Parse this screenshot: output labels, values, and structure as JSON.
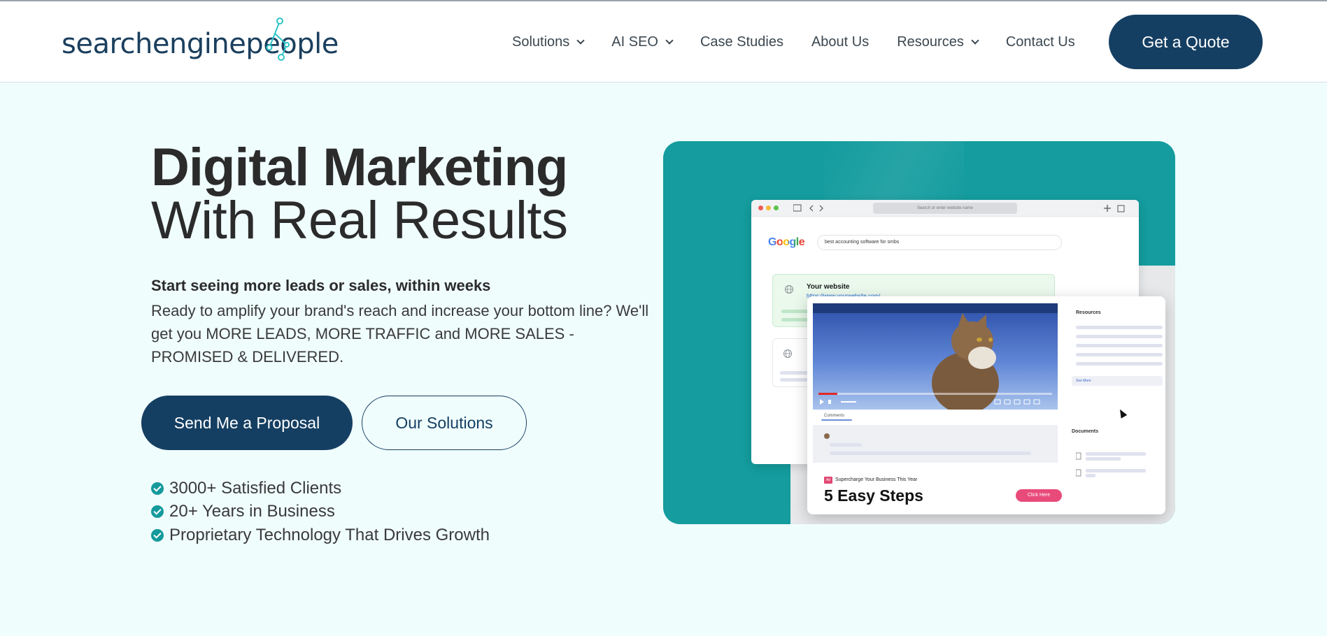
{
  "header": {
    "logo_text": "searchenginepeople",
    "nav": [
      {
        "label": "Solutions",
        "has_dropdown": true
      },
      {
        "label": "AI SEO",
        "has_dropdown": true
      },
      {
        "label": "Case Studies",
        "has_dropdown": false
      },
      {
        "label": "About Us",
        "has_dropdown": false
      },
      {
        "label": "Resources",
        "has_dropdown": true
      },
      {
        "label": "Contact Us",
        "has_dropdown": false
      }
    ],
    "cta_label": "Get a Quote"
  },
  "hero": {
    "title_line1": "Digital Marketing",
    "title_line2": "With Real Results",
    "lead": "Start seeing more leads or sales, within weeks",
    "body": "Ready to amplify your brand's reach and increase your bottom line? We'll get you MORE LEADS, MORE TRAFFIC and MORE SALES - PROMISED & DELIVERED.",
    "primary_button": "Send Me a Proposal",
    "secondary_button": "Our Solutions",
    "features": [
      "3000+ Satisfied Clients",
      "20+ Years in Business",
      "Proprietary Technology That Drives Growth"
    ]
  },
  "illustration": {
    "url_placeholder": "Search or enter website name",
    "google_logo": "Google",
    "search_query": "best accounting software for smbs",
    "result_title": "Your website",
    "result_url": "https://www.yourwebsite.com/",
    "resources_label": "Resources",
    "documents_label": "Documents",
    "comments_label": "Comments",
    "see_more_label": "See More",
    "ad_badge": "Ad",
    "ad_tagline": "Supercharge Your Business This Year",
    "ad_headline": "5 Easy Steps",
    "ad_button": "Click Here",
    "video_progress": 0.08
  },
  "colors": {
    "brand_navy": "#153f62",
    "teal": "#149c9e",
    "page_bg": "#f0fdfd",
    "logo_accent": "#2ec4c6"
  }
}
